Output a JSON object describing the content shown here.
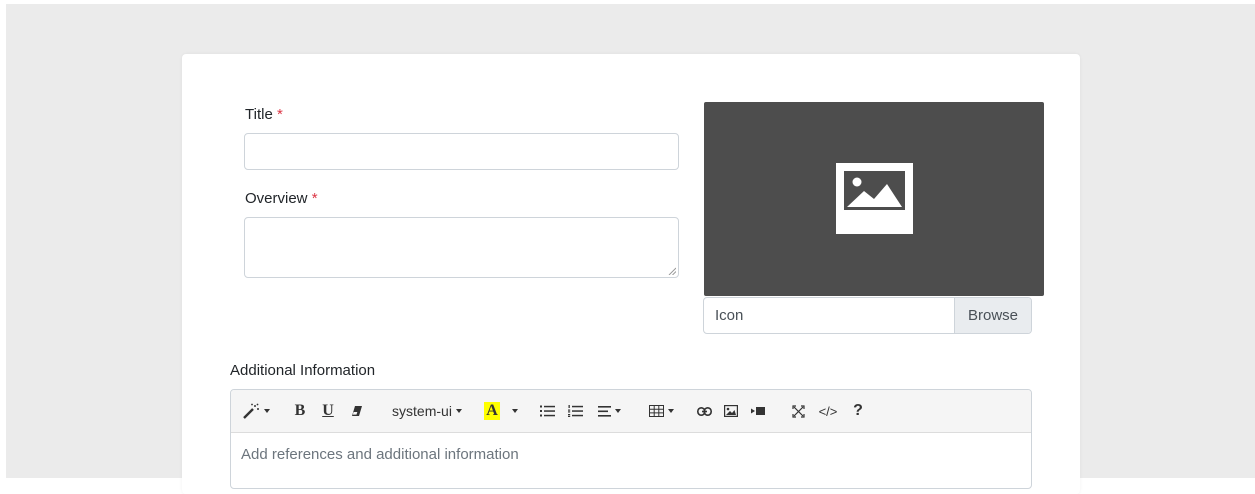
{
  "form": {
    "title_label": "Title",
    "overview_label": "Overview",
    "required_mark": "*",
    "title_value": "",
    "overview_value": "",
    "additional_label": "Additional Information"
  },
  "icon_upload": {
    "file_text": "Icon",
    "browse_label": "Browse"
  },
  "editor": {
    "font_name": "system-ui",
    "code_view_label": "</>",
    "help_label": "?",
    "placeholder": "Add references and additional information",
    "bold_label": "B",
    "underline_label": "U",
    "color_label": "A"
  },
  "colors": {
    "required": "#dc3545",
    "highlight": "#ffff00",
    "image_placeholder_bg": "#4d4d4d"
  }
}
